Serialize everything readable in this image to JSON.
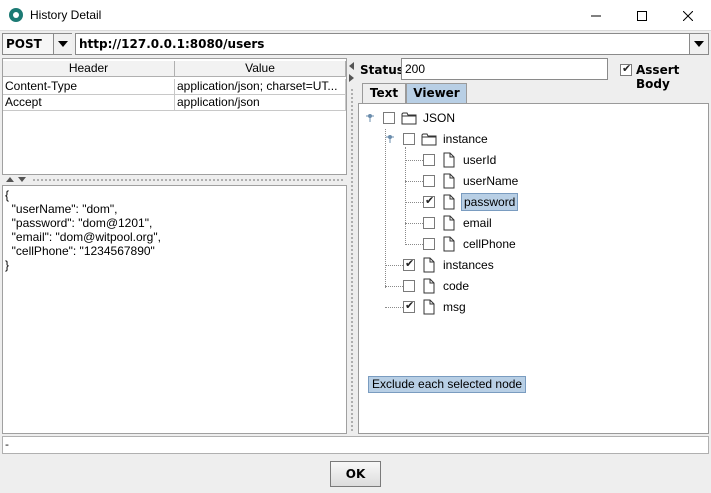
{
  "window": {
    "title": "History Detail"
  },
  "request": {
    "method": "POST",
    "url": "http://127.0.0.1:8080/users"
  },
  "headers_table": {
    "columns": [
      "Header",
      "Value"
    ],
    "rows": [
      {
        "key": "Content-Type",
        "value": "application/json; charset=UT..."
      },
      {
        "key": "Accept",
        "value": "application/json"
      }
    ]
  },
  "body": {
    "text": "{\n  \"userName\": \"dom\",\n  \"password\": \"dom@1201\",\n  \"email\": \"dom@witpool.org\",\n  \"cellPhone\": \"1234567890\"\n}"
  },
  "response": {
    "status_label": "Status:",
    "status_value": "200",
    "assert_body_label": "Assert Body",
    "assert_body_checked": true
  },
  "tabs": [
    {
      "label": "Text",
      "active": false
    },
    {
      "label": "Viewer",
      "active": true
    }
  ],
  "tree": [
    {
      "label": "JSON",
      "type": "folder",
      "checked": false,
      "expanded": true
    },
    {
      "label": "instance",
      "type": "folder",
      "checked": false,
      "expanded": true
    },
    {
      "label": "userId",
      "type": "leaf",
      "checked": false
    },
    {
      "label": "userName",
      "type": "leaf",
      "checked": false
    },
    {
      "label": "password",
      "type": "leaf",
      "checked": true,
      "selected": true
    },
    {
      "label": "email",
      "type": "leaf",
      "checked": false
    },
    {
      "label": "cellPhone",
      "type": "leaf",
      "checked": false
    },
    {
      "label": "instances",
      "type": "leaf",
      "checked": true
    },
    {
      "label": "code",
      "type": "leaf",
      "checked": false
    },
    {
      "label": "msg",
      "type": "leaf",
      "checked": true
    }
  ],
  "tooltip": "Exclude each selected node",
  "status_strip": "-",
  "ok_label": "OK",
  "colors": {
    "selection": "#b8cfe5",
    "app_icon": "#1c7a74"
  },
  "icons": {
    "app": "app-icon",
    "minimize": "minimize-icon",
    "maximize": "maximize-icon",
    "close": "close-icon",
    "dropdown": "chevron-down-icon",
    "folder": "folder-icon",
    "file": "file-icon"
  }
}
